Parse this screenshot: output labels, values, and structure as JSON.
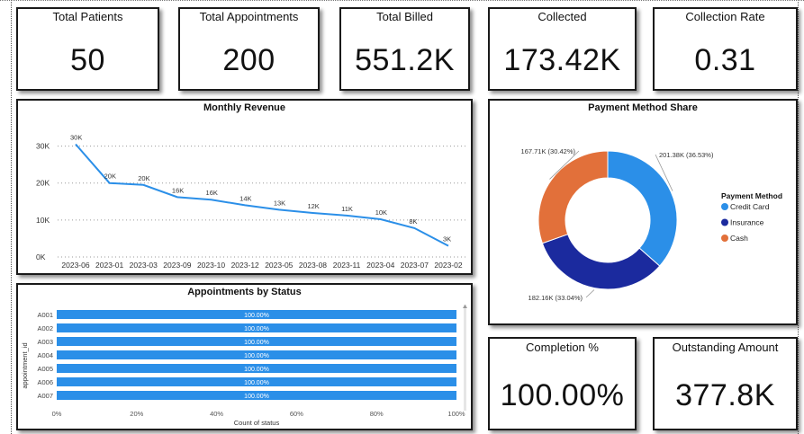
{
  "kpis": {
    "total_patients": {
      "label": "Total Patients",
      "value": "50"
    },
    "total_appointments": {
      "label": "Total Appointments",
      "value": "200"
    },
    "total_billed": {
      "label": "Total Billed",
      "value": "551.2K"
    },
    "collected": {
      "label": "Collected",
      "value": "173.42K"
    },
    "collection_rate": {
      "label": "Collection Rate",
      "value": "0.31"
    },
    "completion": {
      "label": "Completion %",
      "value": "100.00%"
    },
    "outstanding": {
      "label": "Outstanding Amount",
      "value": "377.8K"
    }
  },
  "colors": {
    "line": "#2b8fe8",
    "bar": "#2b8fe8",
    "credit_card": "#2b8fe8",
    "insurance": "#1b2a9e",
    "cash": "#e2703a"
  },
  "chart_data": [
    {
      "type": "line",
      "title": "Monthly Revenue",
      "x": [
        "2023-06",
        "2023-01",
        "2023-03",
        "2023-09",
        "2023-10",
        "2023-12",
        "2023-05",
        "2023-08",
        "2023-11",
        "2023-04",
        "2023-07",
        "2023-02"
      ],
      "values": [
        30500,
        20000,
        19500,
        16200,
        15500,
        14000,
        12800,
        11900,
        11200,
        10200,
        7800,
        3000
      ],
      "data_labels": [
        "30K",
        "20K",
        "20K",
        "16K",
        "16K",
        "14K",
        "13K",
        "12K",
        "11K",
        "10K",
        "8K",
        "3K"
      ],
      "yticks": [
        "0K",
        "10K",
        "20K",
        "30K"
      ],
      "ylim": [
        0,
        35000
      ],
      "grid": true
    },
    {
      "type": "pie",
      "title": "Payment Method Share",
      "legend_title": "Payment Method",
      "legend_position": "right",
      "categories": [
        "Credit Card",
        "Insurance",
        "Cash"
      ],
      "values": [
        201380,
        182160,
        167710
      ],
      "percents": [
        36.53,
        33.04,
        30.42
      ],
      "data_labels": [
        "201.38K (36.53%)",
        "182.16K (33.04%)",
        "167.71K (30.42%)"
      ]
    },
    {
      "type": "bar",
      "orientation": "horizontal",
      "title": "Appointments by Status",
      "ylabel": "appointment_id",
      "xlabel": "Count of status",
      "categories": [
        "A001",
        "A002",
        "A003",
        "A004",
        "A005",
        "A006",
        "A007"
      ],
      "values": [
        100,
        100,
        100,
        100,
        100,
        100,
        100
      ],
      "data_labels": [
        "100.00%",
        "100.00%",
        "100.00%",
        "100.00%",
        "100.00%",
        "100.00%",
        "100.00%"
      ],
      "xticks": [
        "0%",
        "20%",
        "40%",
        "60%",
        "80%",
        "100%"
      ],
      "xlim": [
        0,
        100
      ]
    }
  ]
}
